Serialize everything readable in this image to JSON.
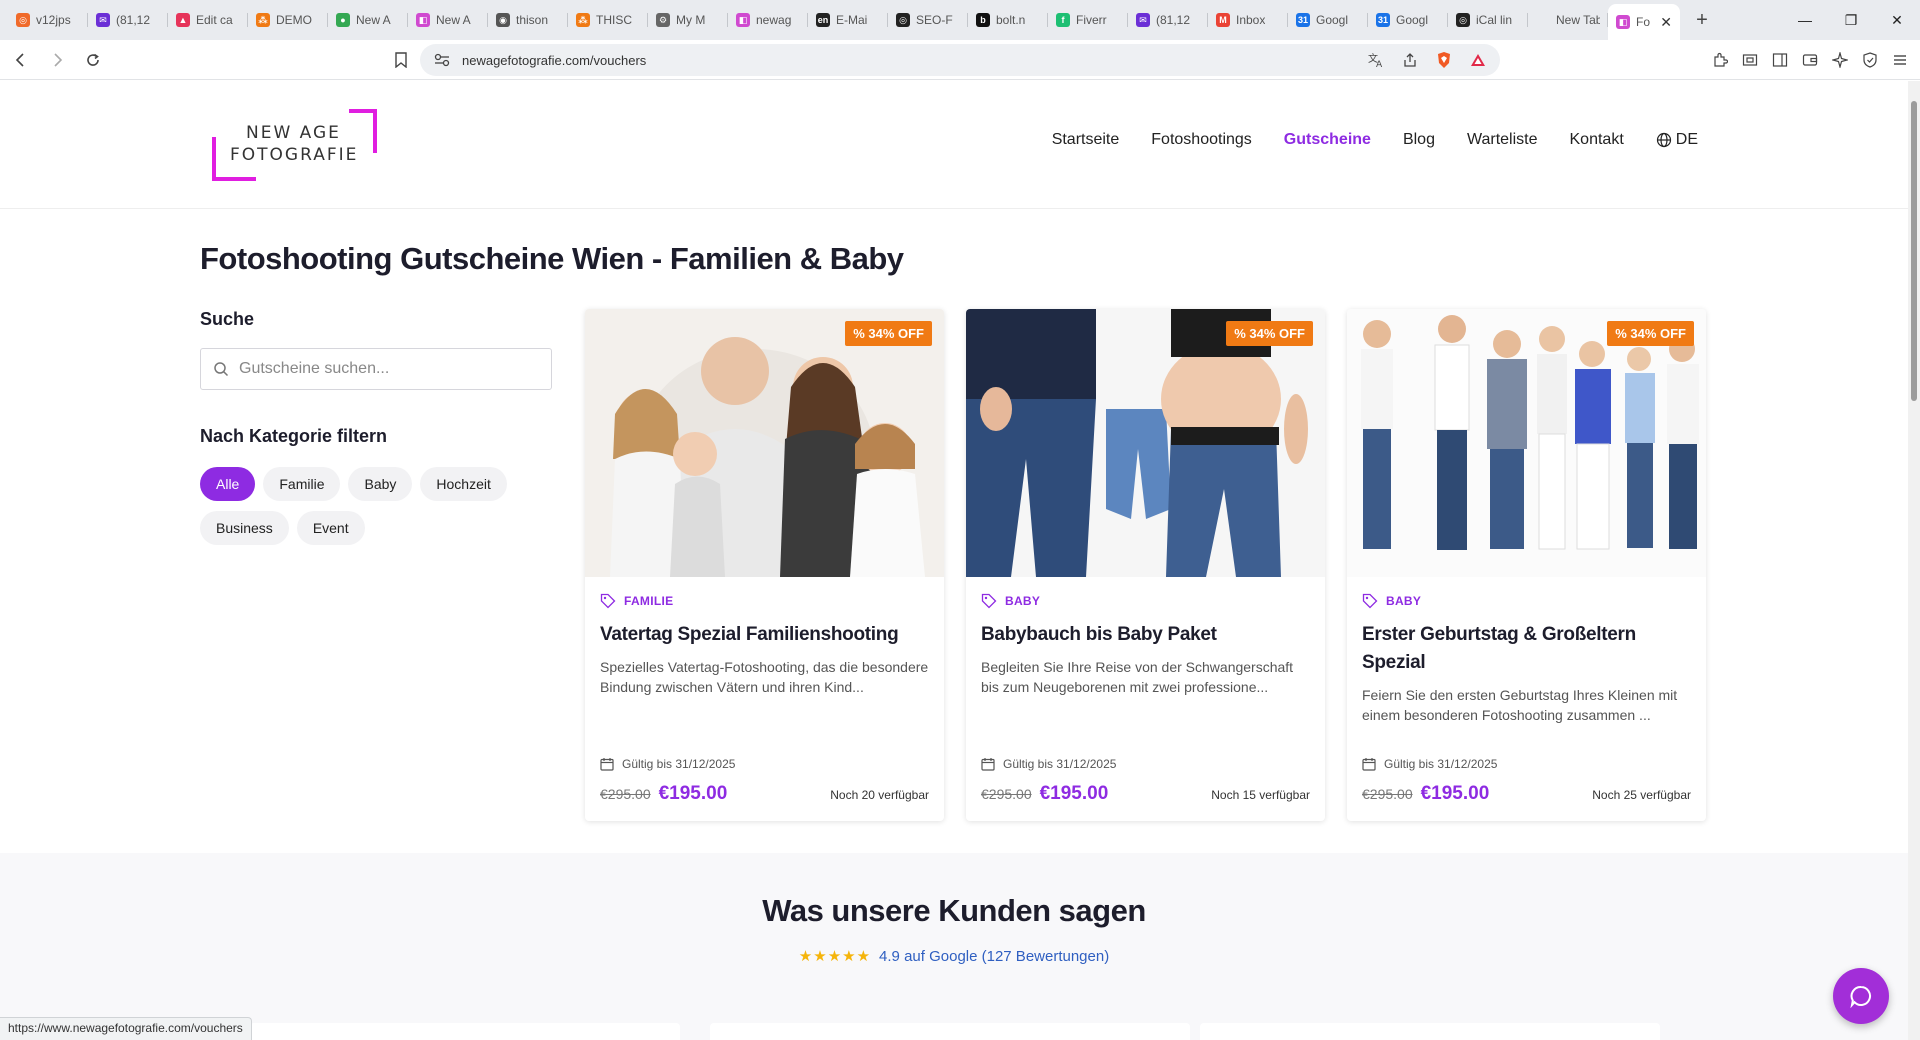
{
  "browser": {
    "tabs": [
      {
        "title": "v12jps",
        "color": "#f06a2a",
        "glyph": "◎"
      },
      {
        "title": "(81,12",
        "color": "#6b2fd6",
        "glyph": "✉"
      },
      {
        "title": "Edit ca",
        "color": "#e6345a",
        "glyph": "▲"
      },
      {
        "title": "DEMO",
        "color": "#f07a14",
        "glyph": "⁂"
      },
      {
        "title": "New A",
        "color": "#34a853",
        "glyph": "●"
      },
      {
        "title": "New A",
        "color": "#d04ad0",
        "glyph": "◧"
      },
      {
        "title": "thison",
        "color": "#555555",
        "glyph": "◉"
      },
      {
        "title": "THISC",
        "color": "#f07a14",
        "glyph": "⁂"
      },
      {
        "title": "My M",
        "color": "#666666",
        "glyph": "⚙"
      },
      {
        "title": "newag",
        "color": "#d04ad0",
        "glyph": "◧"
      },
      {
        "title": "E-Mai",
        "color": "#222222",
        "glyph": "en"
      },
      {
        "title": "SEO-F",
        "color": "#222222",
        "glyph": "◎"
      },
      {
        "title": "bolt.n",
        "color": "#111111",
        "glyph": "b"
      },
      {
        "title": "Fiverr",
        "color": "#1dbf73",
        "glyph": "f"
      },
      {
        "title": "(81,12",
        "color": "#6b2fd6",
        "glyph": "✉"
      },
      {
        "title": "Inbox",
        "color": "#ea4335",
        "glyph": "M"
      },
      {
        "title": "Googl",
        "color": "#1a73e8",
        "glyph": "31"
      },
      {
        "title": "Googl",
        "color": "#1a73e8",
        "glyph": "31"
      },
      {
        "title": "iCal lin",
        "color": "#222222",
        "glyph": "◎"
      },
      {
        "title": "New Tab",
        "color": "transparent",
        "glyph": ""
      }
    ],
    "active_tab": {
      "title": "Fo",
      "color": "#d04ad0",
      "glyph": "◧"
    },
    "url": "newagefotografie.com/vouchers",
    "status_url": "https://www.newagefotografie.com/vouchers"
  },
  "logo": {
    "line1": "NEW AGE",
    "line2": "FOTOGRAFIE"
  },
  "nav": {
    "items": [
      "Startseite",
      "Fotoshootings",
      "Gutscheine",
      "Blog",
      "Warteliste",
      "Kontakt"
    ],
    "active": "Gutscheine",
    "lang": "DE"
  },
  "page_title": "Fotoshooting Gutscheine Wien - Familien & Baby",
  "sidebar": {
    "search_title": "Suche",
    "search_placeholder": "Gutscheine suchen...",
    "filter_title": "Nach Kategorie filtern",
    "categories": [
      "Alle",
      "Familie",
      "Baby",
      "Hochzeit",
      "Business",
      "Event"
    ],
    "active_category": "Alle"
  },
  "vouchers": [
    {
      "badge": "34% OFF",
      "category": "FAMILIE",
      "title": "Vatertag Spezial Familienshooting",
      "description": "Spezielles Vatertag-Fotoshooting, das die besondere Bindung zwischen Vätern und ihren Kind...",
      "valid": "Gültig bis 31/12/2025",
      "old_price": "€295.00",
      "price": "€195.00",
      "availability": "Noch 20 verfügbar"
    },
    {
      "badge": "34% OFF",
      "category": "BABY",
      "title": "Babybauch bis Baby Paket",
      "description": "Begleiten Sie Ihre Reise von der Schwangerschaft bis zum Neugeborenen mit zwei professione...",
      "valid": "Gültig bis 31/12/2025",
      "old_price": "€295.00",
      "price": "€195.00",
      "availability": "Noch 15 verfügbar"
    },
    {
      "badge": "34% OFF",
      "category": "BABY",
      "title": "Erster Geburtstag & Großeltern Spezial",
      "description": "Feiern Sie den ersten Geburtstag Ihres Kleinen mit einem besonderen Fotoshooting zusammen ...",
      "valid": "Gültig bis 31/12/2025",
      "old_price": "€295.00",
      "price": "€195.00",
      "availability": "Noch 25 verfügbar"
    }
  ],
  "reviews": {
    "title": "Was unsere Kunden sagen",
    "stars": "★★★★★",
    "rating_text": "4.9 auf Google (127 Bewertungen)"
  },
  "colors": {
    "accent": "#8e2be2",
    "badge": "#f07a14",
    "logo": "#e01ee0",
    "chat": "#a22ed8"
  }
}
